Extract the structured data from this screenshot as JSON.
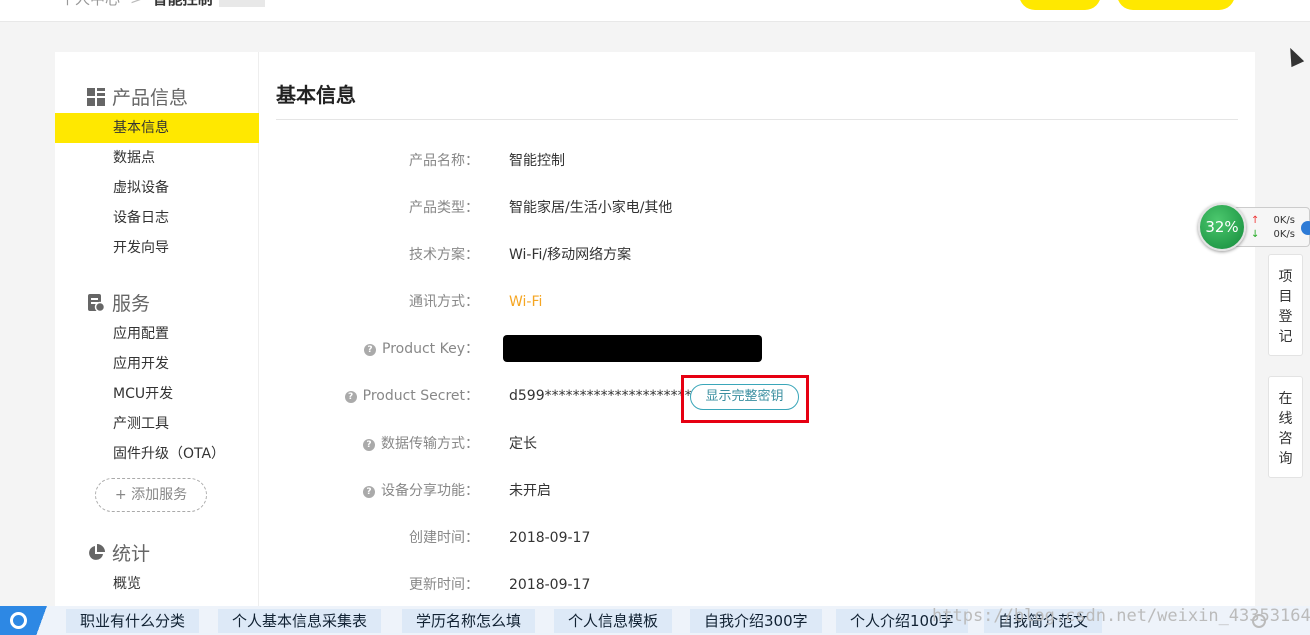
{
  "breadcrumb": {
    "parent": "个人中心",
    "current": "智能控制"
  },
  "sidebar": {
    "sections": [
      {
        "title": "产品信息",
        "icon": "grid-icon"
      },
      {
        "title": "服务",
        "icon": "service-icon"
      },
      {
        "title": "统计",
        "icon": "pie-chart-icon"
      }
    ],
    "product_items": [
      "基本信息",
      "数据点",
      "虚拟设备",
      "设备日志",
      "开发向导"
    ],
    "service_items": [
      "应用配置",
      "应用开发",
      "MCU开发",
      "产测工具",
      "固件升级（OTA）"
    ],
    "add_service": "+ 添加服务",
    "stats_items": [
      "概览"
    ]
  },
  "main": {
    "title": "基本信息",
    "fields": [
      {
        "label": "产品名称：",
        "value": "智能控制"
      },
      {
        "label": "产品类型：",
        "value": "智能家居/生活小家电/其他"
      },
      {
        "label": "技术方案：",
        "value": "Wi-Fi/移动网络方案"
      },
      {
        "label": "通讯方式：",
        "value": "Wi-Fi"
      },
      {
        "label": "Product Key：",
        "value": ""
      },
      {
        "label": "Product Secret：",
        "value": "d599*********************f53b"
      },
      {
        "label": "数据传输方式：",
        "value": "定长"
      },
      {
        "label": "设备分享功能：",
        "value": "未开启"
      },
      {
        "label": "创建时间：",
        "value": "2018-09-17"
      },
      {
        "label": "更新时间：",
        "value": "2018-09-17"
      }
    ],
    "show_key_button": "显示完整密钥",
    "help_mark": "?"
  },
  "overlay": {
    "percent": "32%",
    "up_rate": "0K/s",
    "down_rate": "0K/s",
    "up_arrow": "↑",
    "down_arrow": "↓"
  },
  "right_tabs": {
    "register": "项\n目\n登\n记",
    "consult": "在\n线\n咨\n询"
  },
  "bottom_links": [
    "职业有什么分类",
    "个人基本信息采集表",
    "学历名称怎么填",
    "个人信息模板",
    "自我介绍300字",
    "个人介绍100字",
    "自我简介范文"
  ],
  "watermark": "https://blog.csdn.net/weixin_43353164",
  "colors": {
    "accent": "#ffe800",
    "highlight_border": "#e60012",
    "link_orange": "#f5a623",
    "button_teal": "#3aa6b9"
  }
}
